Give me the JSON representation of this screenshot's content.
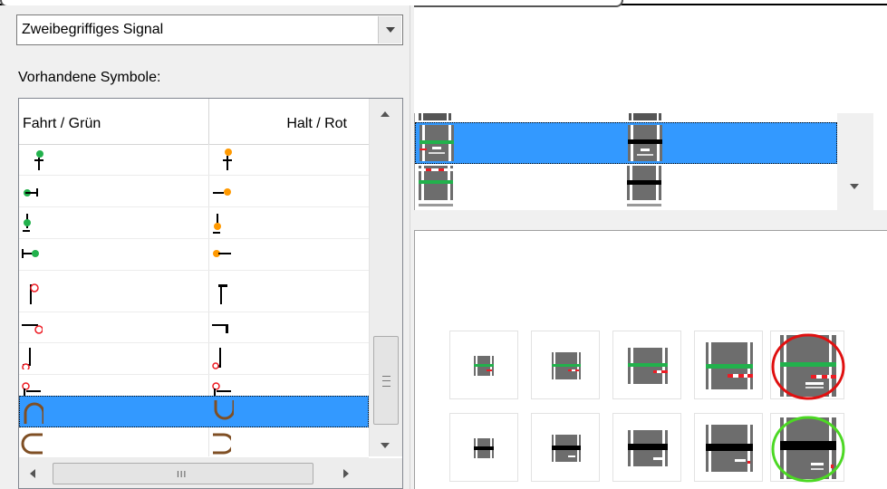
{
  "signal_type": {
    "value": "Zweibegriffiges Signal",
    "dropdown_icon": "chevron-down-icon"
  },
  "symbols_label": "Vorhandene Symbole:",
  "symbol_list": {
    "columns": [
      "Fahrt / Grün",
      "Halt / Rot"
    ],
    "selected_row": 8,
    "hscroll_grip": "III"
  },
  "colors": {
    "selection": "#3399ff",
    "green": "#22b14c",
    "orange": "#ff9900",
    "red": "#ed1c24",
    "brown": "#7f4f24",
    "circle_red": "#e01010",
    "circle_green": "#4cd824"
  }
}
